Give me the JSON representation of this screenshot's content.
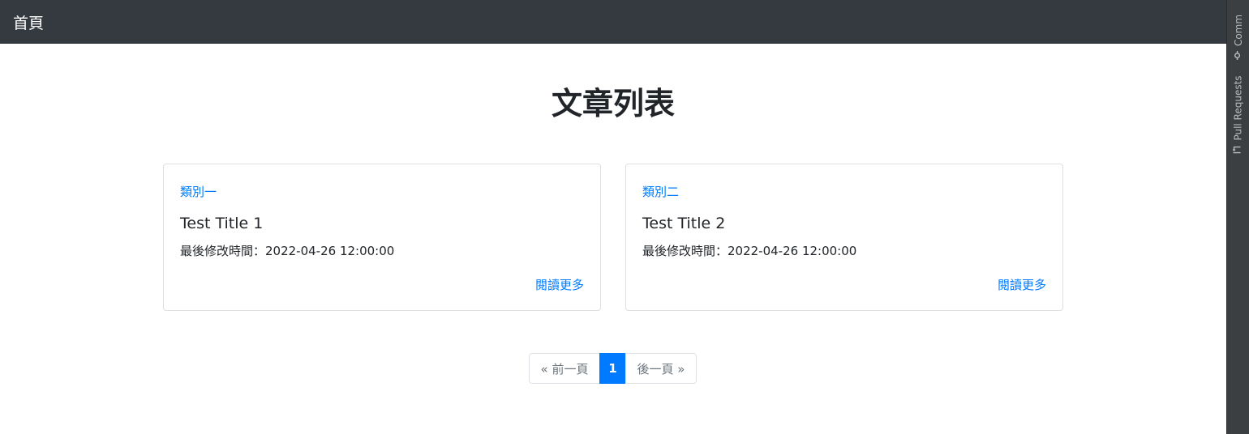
{
  "navbar": {
    "brand": "首頁"
  },
  "main": {
    "heading": "文章列表",
    "posts": [
      {
        "category": "類別一",
        "title": "Test Title 1",
        "modified": "最後修改時間：2022-04-26 12:00:00",
        "read_more": "閱讀更多"
      },
      {
        "category": "類別二",
        "title": "Test Title 2",
        "modified": "最後修改時間：2022-04-26 12:00:00",
        "read_more": "閱讀更多"
      }
    ]
  },
  "pagination": {
    "prev_label": "« 前一頁",
    "current_page": "1",
    "next_label": "後一頁 »"
  },
  "side_rail": {
    "commit_label": "Comm",
    "pull_requests_label": "Pull Requests",
    "commit_icon": "commit-icon",
    "pull_request_icon": "pull-request-icon"
  },
  "colors": {
    "navbar_bg": "#343a40",
    "link": "#007bff",
    "active_page": "#007bff",
    "rail_bg": "#3c3f41"
  }
}
